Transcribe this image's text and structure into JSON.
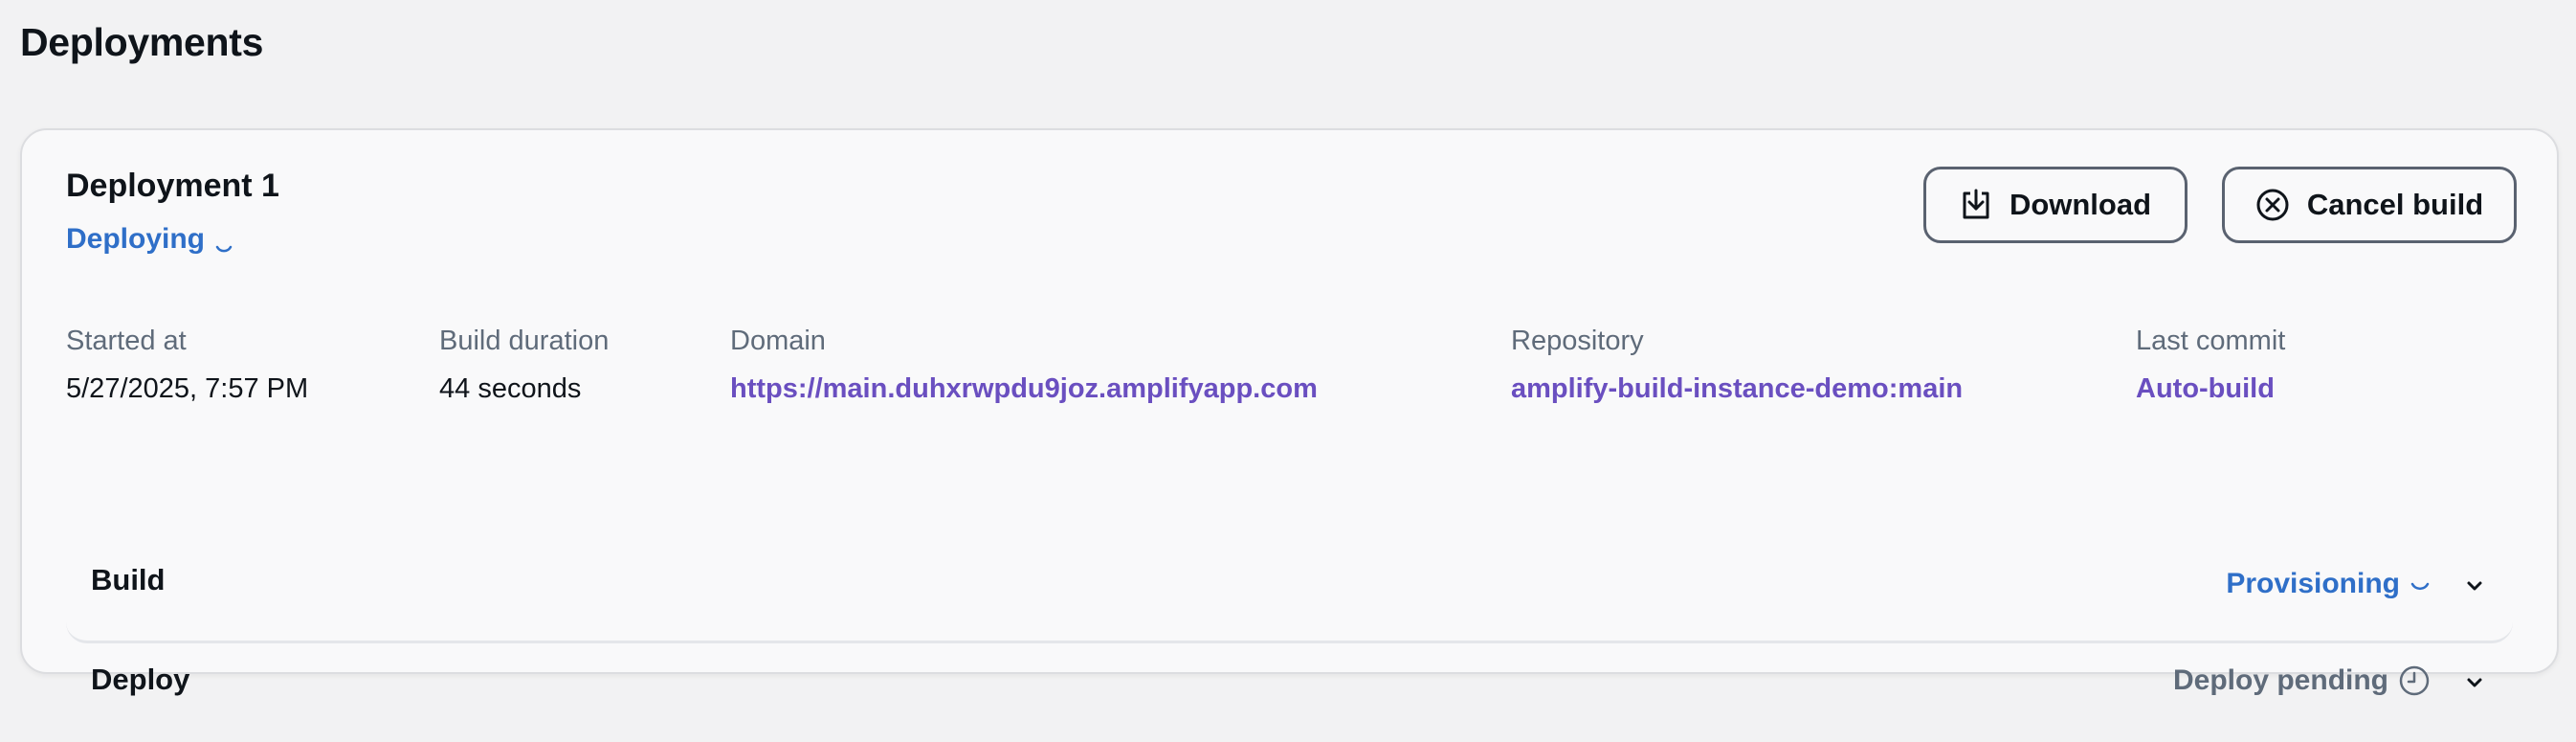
{
  "page": {
    "title": "Deployments"
  },
  "deployment": {
    "title": "Deployment 1",
    "status": "Deploying",
    "actions": {
      "download_label": "Download",
      "cancel_label": "Cancel build"
    },
    "details": {
      "started_at": {
        "label": "Started at",
        "value": "5/27/2025, 7:57 PM"
      },
      "build_duration": {
        "label": "Build duration",
        "value": "44 seconds"
      },
      "domain": {
        "label": "Domain",
        "value": "https://main.duhxrwpdu9joz.amplifyapp.com"
      },
      "repository": {
        "label": "Repository",
        "value": "amplify-build-instance-demo:main"
      },
      "last_commit": {
        "label": "Last commit",
        "value": "Auto-build"
      }
    },
    "sections": [
      {
        "name": "Build",
        "status": "Provisioning",
        "status_icon": "spinner-icon"
      },
      {
        "name": "Deploy",
        "status": "Deploy pending",
        "status_icon": "clock-icon"
      }
    ]
  },
  "colors": {
    "in_progress_blue": "#2f6fc8",
    "link_purple": "#6a4fc0",
    "muted_gray": "#5f6b7a",
    "text_dark": "#0f141a"
  }
}
